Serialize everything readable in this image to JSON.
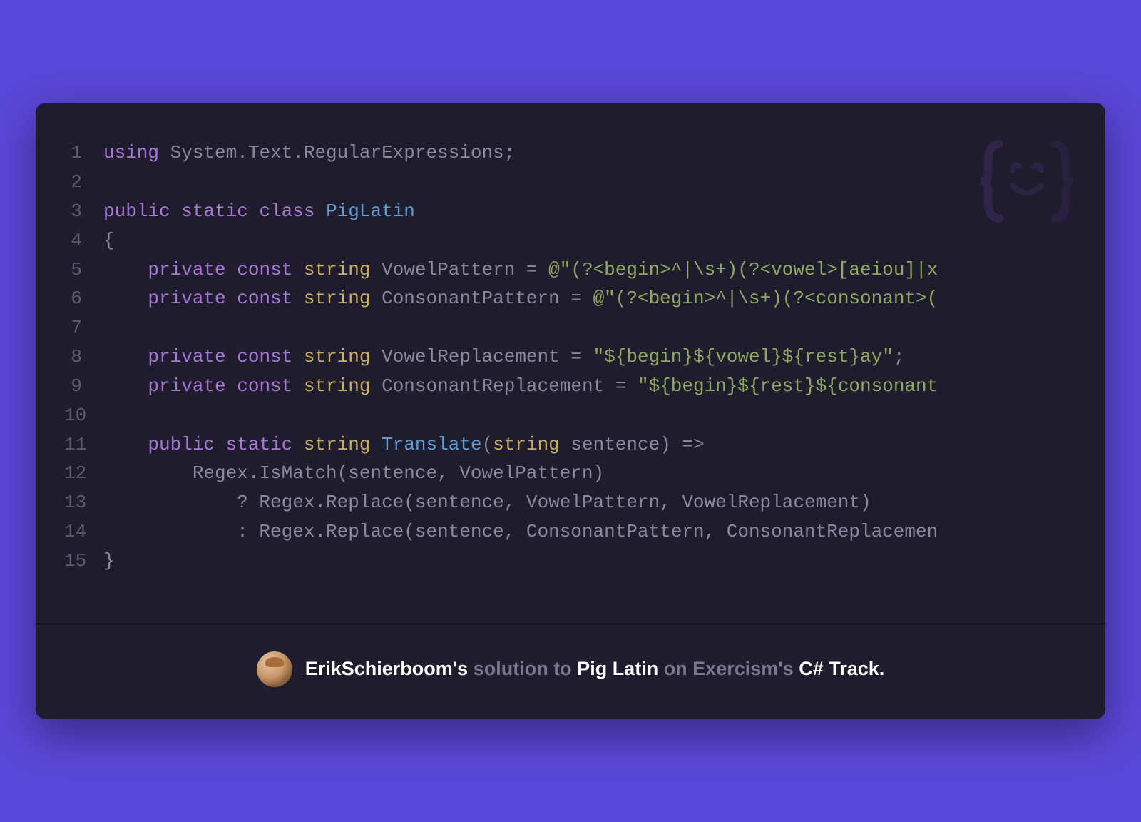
{
  "code": {
    "lines": [
      {
        "n": "1",
        "tokens": [
          {
            "t": "using",
            "c": "kw"
          },
          {
            "t": " System.Text.RegularExpressions;",
            "c": "punc"
          }
        ]
      },
      {
        "n": "2",
        "tokens": []
      },
      {
        "n": "3",
        "tokens": [
          {
            "t": "public",
            "c": "kw"
          },
          {
            "t": " ",
            "c": ""
          },
          {
            "t": "static",
            "c": "kw"
          },
          {
            "t": " ",
            "c": ""
          },
          {
            "t": "class",
            "c": "kw"
          },
          {
            "t": " ",
            "c": ""
          },
          {
            "t": "PigLatin",
            "c": "cls"
          }
        ]
      },
      {
        "n": "4",
        "tokens": [
          {
            "t": "{",
            "c": "punc"
          }
        ]
      },
      {
        "n": "5",
        "tokens": [
          {
            "t": "    ",
            "c": ""
          },
          {
            "t": "private",
            "c": "kw"
          },
          {
            "t": " ",
            "c": ""
          },
          {
            "t": "const",
            "c": "kw"
          },
          {
            "t": " ",
            "c": ""
          },
          {
            "t": "string",
            "c": "type"
          },
          {
            "t": " VowelPattern = ",
            "c": "punc"
          },
          {
            "t": "@\"(?<begin>^|\\s+)(?<vowel>[aeiou]|x",
            "c": "str"
          }
        ]
      },
      {
        "n": "6",
        "tokens": [
          {
            "t": "    ",
            "c": ""
          },
          {
            "t": "private",
            "c": "kw"
          },
          {
            "t": " ",
            "c": ""
          },
          {
            "t": "const",
            "c": "kw"
          },
          {
            "t": " ",
            "c": ""
          },
          {
            "t": "string",
            "c": "type"
          },
          {
            "t": " ConsonantPattern = ",
            "c": "punc"
          },
          {
            "t": "@\"(?<begin>^|\\s+)(?<consonant>(",
            "c": "str"
          }
        ]
      },
      {
        "n": "7",
        "tokens": []
      },
      {
        "n": "8",
        "tokens": [
          {
            "t": "    ",
            "c": ""
          },
          {
            "t": "private",
            "c": "kw"
          },
          {
            "t": " ",
            "c": ""
          },
          {
            "t": "const",
            "c": "kw"
          },
          {
            "t": " ",
            "c": ""
          },
          {
            "t": "string",
            "c": "type"
          },
          {
            "t": " VowelReplacement = ",
            "c": "punc"
          },
          {
            "t": "\"${begin}${vowel}${rest}ay\"",
            "c": "str"
          },
          {
            "t": ";",
            "c": "punc"
          }
        ]
      },
      {
        "n": "9",
        "tokens": [
          {
            "t": "    ",
            "c": ""
          },
          {
            "t": "private",
            "c": "kw"
          },
          {
            "t": " ",
            "c": ""
          },
          {
            "t": "const",
            "c": "kw"
          },
          {
            "t": " ",
            "c": ""
          },
          {
            "t": "string",
            "c": "type"
          },
          {
            "t": " ConsonantReplacement = ",
            "c": "punc"
          },
          {
            "t": "\"${begin}${rest}${consonant",
            "c": "str"
          }
        ]
      },
      {
        "n": "10",
        "tokens": []
      },
      {
        "n": "11",
        "tokens": [
          {
            "t": "    ",
            "c": ""
          },
          {
            "t": "public",
            "c": "kw"
          },
          {
            "t": " ",
            "c": ""
          },
          {
            "t": "static",
            "c": "kw"
          },
          {
            "t": " ",
            "c": ""
          },
          {
            "t": "string",
            "c": "type"
          },
          {
            "t": " ",
            "c": ""
          },
          {
            "t": "Translate",
            "c": "method"
          },
          {
            "t": "(",
            "c": "punc"
          },
          {
            "t": "string",
            "c": "type"
          },
          {
            "t": " sentence) =>",
            "c": "punc"
          }
        ]
      },
      {
        "n": "12",
        "tokens": [
          {
            "t": "        Regex.IsMatch(sentence, VowelPattern)",
            "c": "punc"
          }
        ]
      },
      {
        "n": "13",
        "tokens": [
          {
            "t": "            ? Regex.Replace(sentence, VowelPattern, VowelReplacement)",
            "c": "punc"
          }
        ]
      },
      {
        "n": "14",
        "tokens": [
          {
            "t": "            : Regex.Replace(sentence, ConsonantPattern, ConsonantReplacemen",
            "c": "punc"
          }
        ]
      },
      {
        "n": "15",
        "tokens": [
          {
            "t": "}",
            "c": "punc"
          }
        ]
      }
    ]
  },
  "footer": {
    "author": "ErikSchierboom's",
    "text1": " solution to ",
    "exercise": "Pig Latin",
    "text2": " on Exercism's ",
    "track": "C# Track."
  }
}
